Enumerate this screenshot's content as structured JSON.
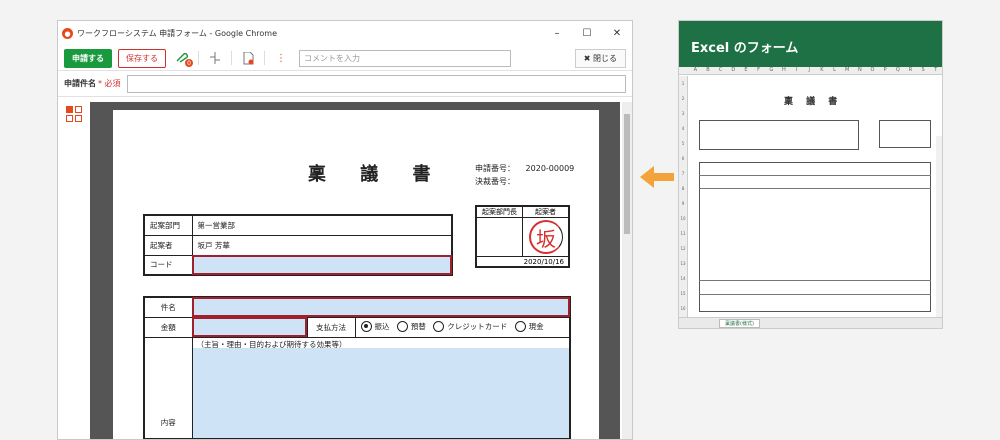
{
  "window": {
    "title": "ワークフローシステム 申請フォーム - Google Chrome",
    "controls": [
      "–",
      "☐",
      "✕"
    ]
  },
  "toolbar": {
    "apply_label": "申請する",
    "save_label": "保存する",
    "attach_badge": "0",
    "comment_placeholder": "コメントを入力",
    "close_label": "✖ 閉じる"
  },
  "subject": {
    "label": "申請件名",
    "required_mark": "* 必須"
  },
  "document": {
    "title": "稟 議 書",
    "app_no_label": "申請番号：",
    "app_no_value": "2020-00009",
    "decision_no_label": "決裁番号：",
    "dept_label": "起案部門",
    "dept_value": "第一営業部",
    "drafter_label": "起案者",
    "drafter_value": "坂戸 芳華",
    "code_label": "コード",
    "stamp_head_left": "起案部門長",
    "stamp_head_right": "起案者",
    "seal_char": "坂",
    "stamp_date": "2020/10/16",
    "item_label": "件名",
    "amount_label": "金額",
    "payment_label": "支払方法",
    "payment_options": [
      "振込",
      "預替",
      "クレジットカード",
      "現金"
    ],
    "content_note": "（主旨・理由・目的および期待する効果等）",
    "content_label": "内容"
  },
  "excel": {
    "heading": "Excel のフォーム",
    "sheet_title": "稟 議 書",
    "columns": [
      "A",
      "B",
      "C",
      "D",
      "E",
      "F",
      "G",
      "H",
      "I",
      "J",
      "K",
      "L",
      "M",
      "N",
      "O",
      "P",
      "Q",
      "R",
      "S",
      "T"
    ],
    "row_numbers": [
      "1",
      "2",
      "3",
      "4",
      "5",
      "6",
      "7",
      "8",
      "9",
      "10",
      "11",
      "12",
      "13",
      "14",
      "15",
      "16"
    ],
    "sheet_tab": "稟議書(様式)"
  }
}
